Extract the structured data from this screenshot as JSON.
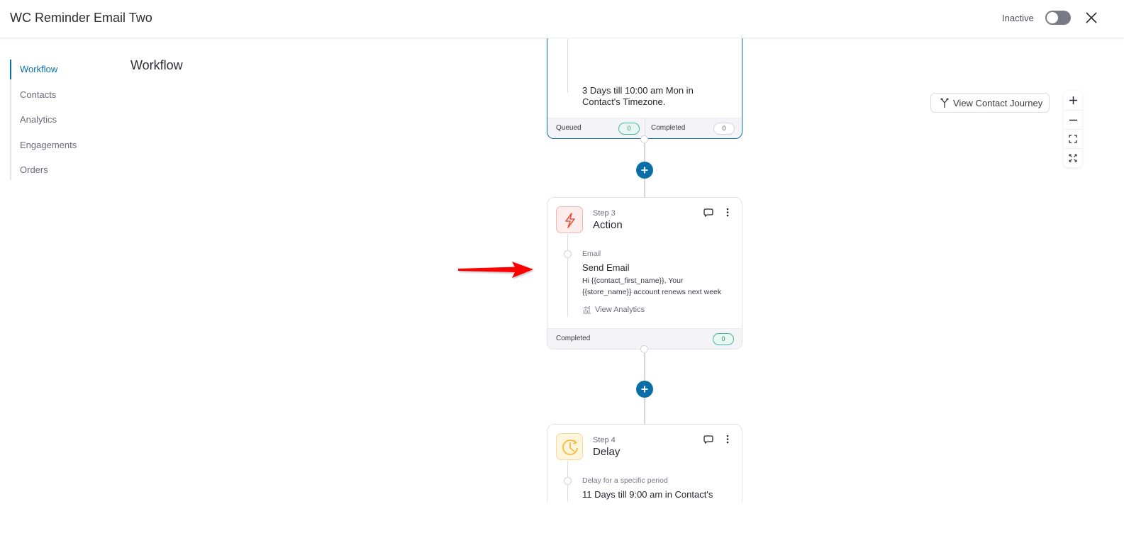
{
  "header": {
    "title": "WC Reminder Email Two",
    "status_label": "Inactive",
    "toggle_on": false
  },
  "sidebar": {
    "items": [
      {
        "label": "Workflow",
        "active": true
      },
      {
        "label": "Contacts",
        "active": false
      },
      {
        "label": "Analytics",
        "active": false
      },
      {
        "label": "Engagements",
        "active": false
      },
      {
        "label": "Orders",
        "active": false
      }
    ]
  },
  "page": {
    "title": "Workflow"
  },
  "toolbar": {
    "view_contact_journey": "View Contact Journey",
    "zoom_in_icon": "plus-icon",
    "zoom_out_icon": "minus-icon",
    "fit_icon": "fit-screen-icon",
    "fullscreen_icon": "expand-icon"
  },
  "workflow": {
    "previous_step": {
      "detail_line1": "3 Days till 10:00 am Mon in",
      "detail_line2": "Contact's Timezone.",
      "queued_label": "Queued",
      "queued_count": "0",
      "completed_label": "Completed",
      "completed_count": "0"
    },
    "step3": {
      "step_label": "Step 3",
      "title": "Action",
      "icon": "lightning-icon",
      "sub_label": "Email",
      "main_text": "Send Email",
      "desc_line1": "Hi {{contact_first_name}}, Your",
      "desc_line2": "{{store_name}} account renews next week",
      "analytics_link": "View Analytics",
      "completed_label": "Completed",
      "completed_count": "0"
    },
    "step4": {
      "step_label": "Step 4",
      "title": "Delay",
      "icon": "clock-icon",
      "sub_label": "Delay for a specific period",
      "main_text": "11 Days till 9:00 am in Contact's"
    }
  },
  "annotation": {
    "arrow_color": "#ff0000"
  },
  "colors": {
    "accent": "#0a6fa6",
    "badge_green": "#47b69b",
    "action_red": "#e8533f",
    "delay_yellow": "#f7b731"
  }
}
